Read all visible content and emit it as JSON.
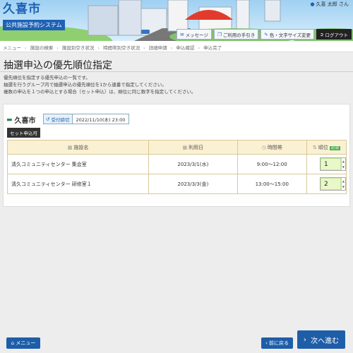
{
  "header": {
    "city": "久喜市",
    "system_name": "公共施設予約システム",
    "user_name": "久喜 太郎 さん",
    "buttons": [
      {
        "label": "メッセージ",
        "icon": "chat-icon"
      },
      {
        "label": "ご利用の手引き",
        "icon": "book-icon"
      },
      {
        "label": "色・文字サイズ変更",
        "icon": "brush-icon"
      },
      {
        "label": "ログアウト",
        "icon": "logout-icon"
      }
    ]
  },
  "breadcrumb": [
    "メニュー",
    "施設の検索",
    "施設別空き状況",
    "時間帯別空き状況",
    "詳細申請",
    "申込確認",
    "申込完了"
  ],
  "page": {
    "title": "抽選申込の優先順位指定",
    "desc": [
      "優先順位を指定する優先申込の一覧です。",
      "抽選を行うグループ内で抽選申込の優先順位を1から連番で指定してください。",
      "複数の申込を１つの申込とする場合（セット申込）は、順位に同じ数字を指定してください。"
    ]
  },
  "group": {
    "city": "久喜市",
    "deadline_label": "受付締切",
    "deadline": "2022/11/10(木) 23:00",
    "set_badge": "セット申込可"
  },
  "table": {
    "headers": {
      "facility": "施設名",
      "date": "利用日",
      "time": "時間帯",
      "rank": "順位",
      "required": "必須"
    },
    "rows": [
      {
        "facility": "清久コミュニティセンター 集会室",
        "date": "2023/3/1(水)",
        "time": "9:00～12:00",
        "rank": "1"
      },
      {
        "facility": "清久コミュニティセンター 研修室１",
        "date": "2023/3/3(金)",
        "time": "13:00～15:00",
        "rank": "2"
      }
    ]
  },
  "footer": {
    "menu": "メニュー",
    "back": "前に戻る",
    "next": "次へ進む"
  },
  "colors": {
    "primary": "#1e5ea8",
    "table_header": "#faf0d2",
    "required": "#4caf50",
    "input_bg": "#e9f8c9"
  }
}
